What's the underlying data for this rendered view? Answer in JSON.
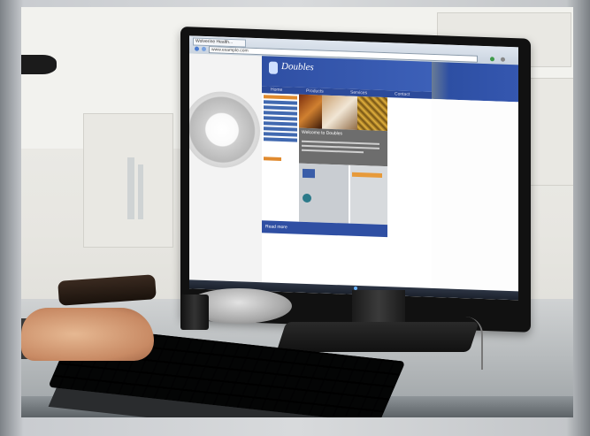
{
  "scene": {
    "description_type": "photo",
    "browser": {
      "tab_title": "Wolverine Health...",
      "address": "www.example.com"
    },
    "website": {
      "logo_text": "Doubles",
      "nav_items": [
        "Home",
        "Products",
        "Services",
        "Contact"
      ],
      "info_title": "Welcome to Doubles",
      "footer_text": "Read more"
    }
  }
}
